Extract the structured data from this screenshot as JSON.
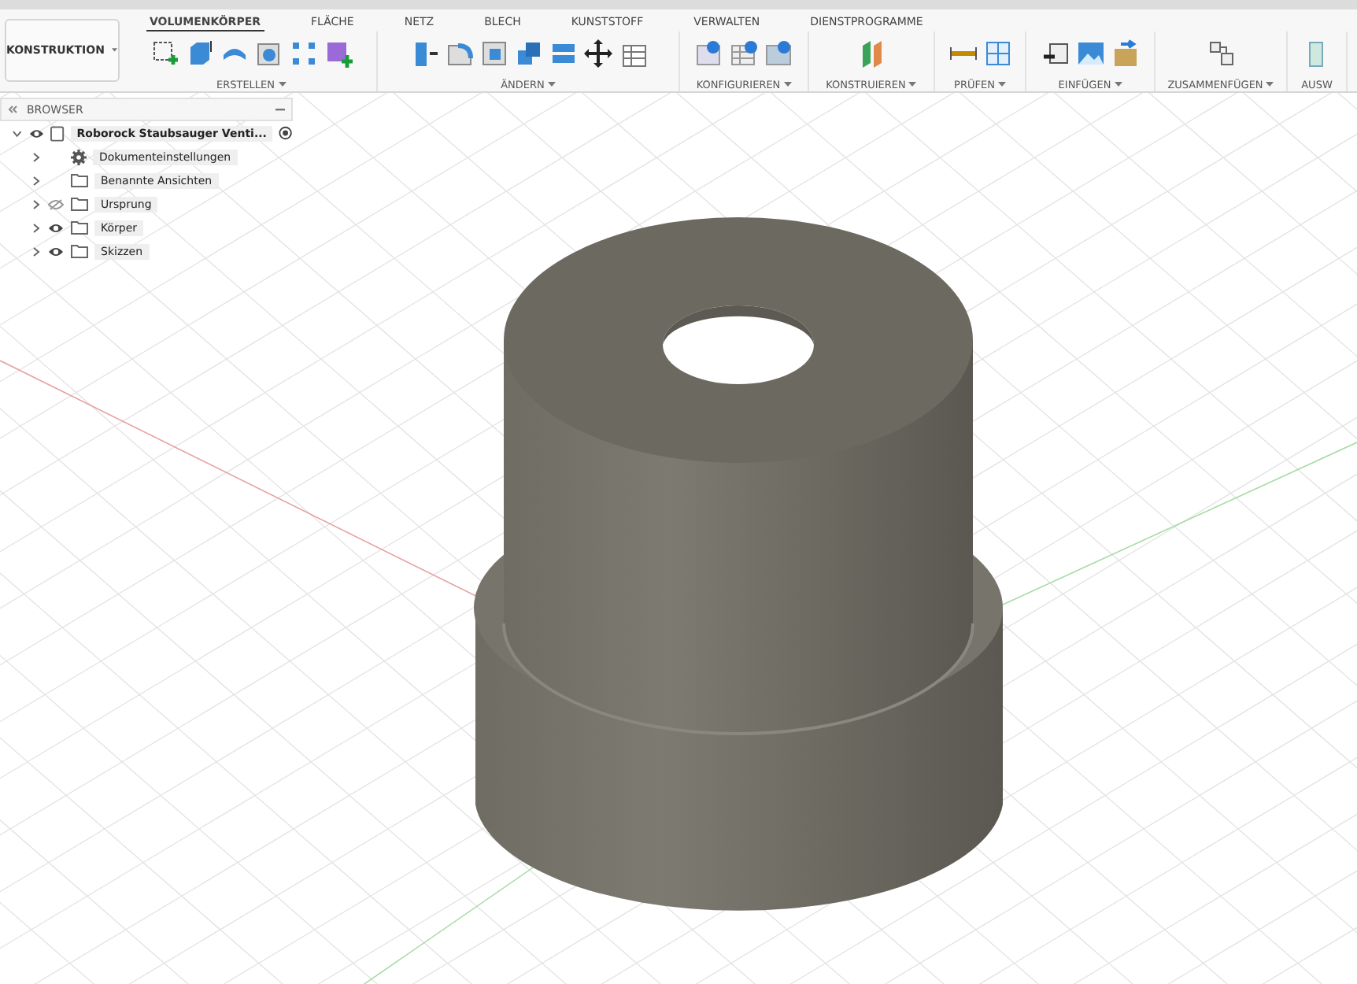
{
  "workspace_menu": {
    "label": "KONSTRUKTION"
  },
  "tabs": [
    {
      "label": "VOLUMENKÖRPER",
      "selected": true
    },
    {
      "label": "FLÄCHE",
      "selected": false
    },
    {
      "label": "NETZ",
      "selected": false
    },
    {
      "label": "BLECH",
      "selected": false
    },
    {
      "label": "KUNSTSTOFF",
      "selected": false
    },
    {
      "label": "VERWALTEN",
      "selected": false
    },
    {
      "label": "DIENSTPROGRAMME",
      "selected": false
    }
  ],
  "groups": [
    {
      "label": "ERSTELLEN"
    },
    {
      "label": "ÄNDERN"
    },
    {
      "label": "KONFIGURIEREN"
    },
    {
      "label": "KONSTRUIEREN"
    },
    {
      "label": "PRÜFEN"
    },
    {
      "label": "EINFÜGEN"
    },
    {
      "label": "ZUSAMMENFÜGEN"
    },
    {
      "label": "AUSW"
    }
  ],
  "browser": {
    "title": "BROWSER",
    "root": {
      "label": "Roborock Staubsauger Venti...",
      "expanded": true,
      "visible": true,
      "children": [
        {
          "label": "Dokumenteinstellungen",
          "kind": "settings"
        },
        {
          "label": "Benannte Ansichten",
          "kind": "folder"
        },
        {
          "label": "Ursprung",
          "kind": "folder",
          "visible": false
        },
        {
          "label": "Körper",
          "kind": "folder",
          "visible": true
        },
        {
          "label": "Skizzen",
          "kind": "folder",
          "visible": true
        }
      ]
    }
  }
}
